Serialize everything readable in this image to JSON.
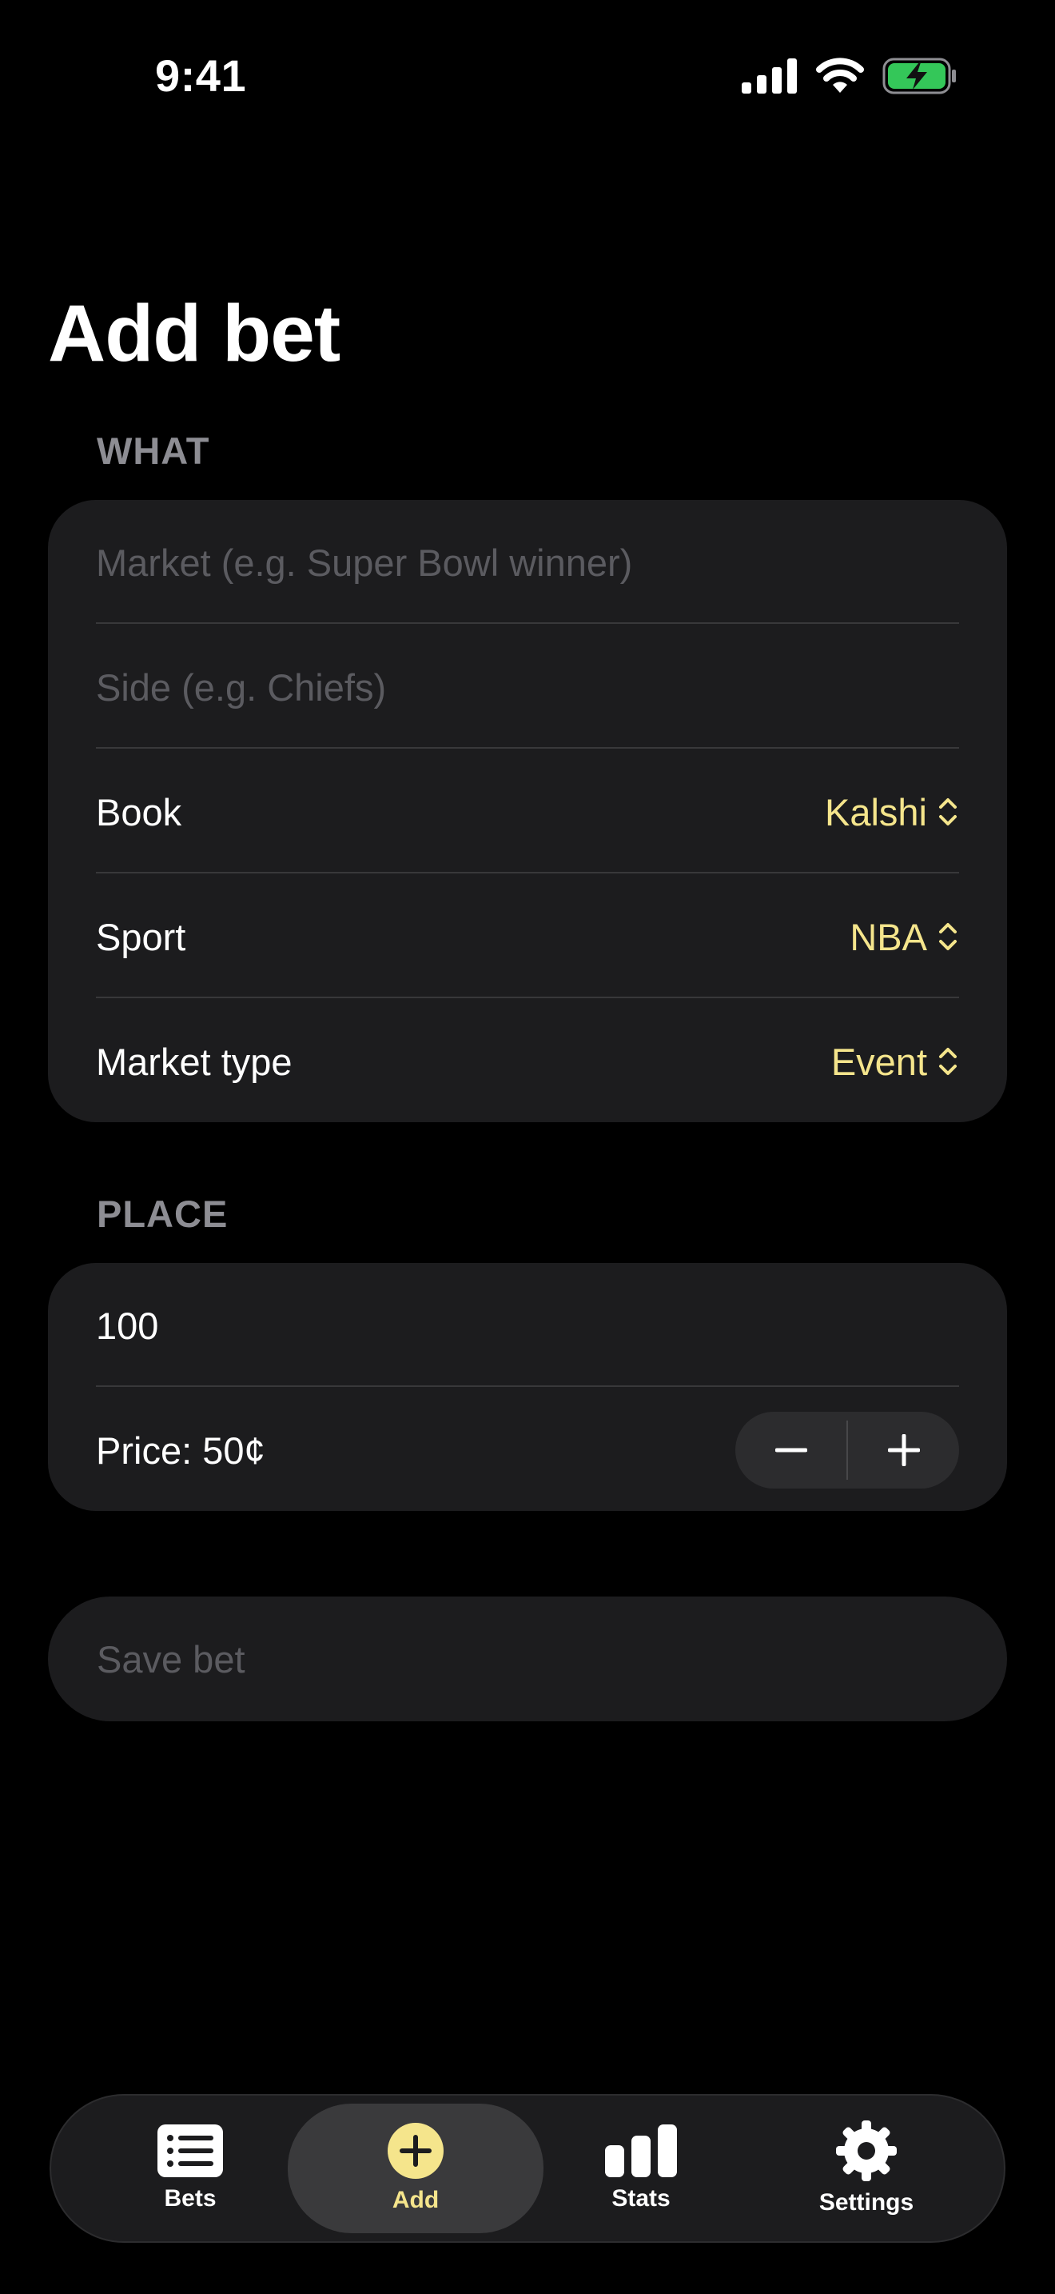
{
  "status_bar": {
    "time": "9:41"
  },
  "title": "Add bet",
  "sections": {
    "what": {
      "header": "WHAT",
      "market_placeholder": "Market (e.g. Super Bowl winner)",
      "side_placeholder": "Side (e.g. Chiefs)",
      "book": {
        "label": "Book",
        "value": "Kalshi"
      },
      "sport": {
        "label": "Sport",
        "value": "NBA"
      },
      "market_type": {
        "label": "Market type",
        "value": "Event"
      }
    },
    "place": {
      "header": "PLACE",
      "amount_value": "100",
      "price_label": "Price: 50¢"
    }
  },
  "save_button": "Save bet",
  "tabs": [
    {
      "label": "Bets",
      "icon": "list-icon"
    },
    {
      "label": "Add",
      "icon": "plus-circle-icon"
    },
    {
      "label": "Stats",
      "icon": "bar-chart-icon"
    },
    {
      "label": "Settings",
      "icon": "gear-icon"
    }
  ],
  "colors": {
    "accent": "#f5e58c",
    "card": "#1c1c1e",
    "background": "#000000",
    "battery": "#34c759"
  }
}
